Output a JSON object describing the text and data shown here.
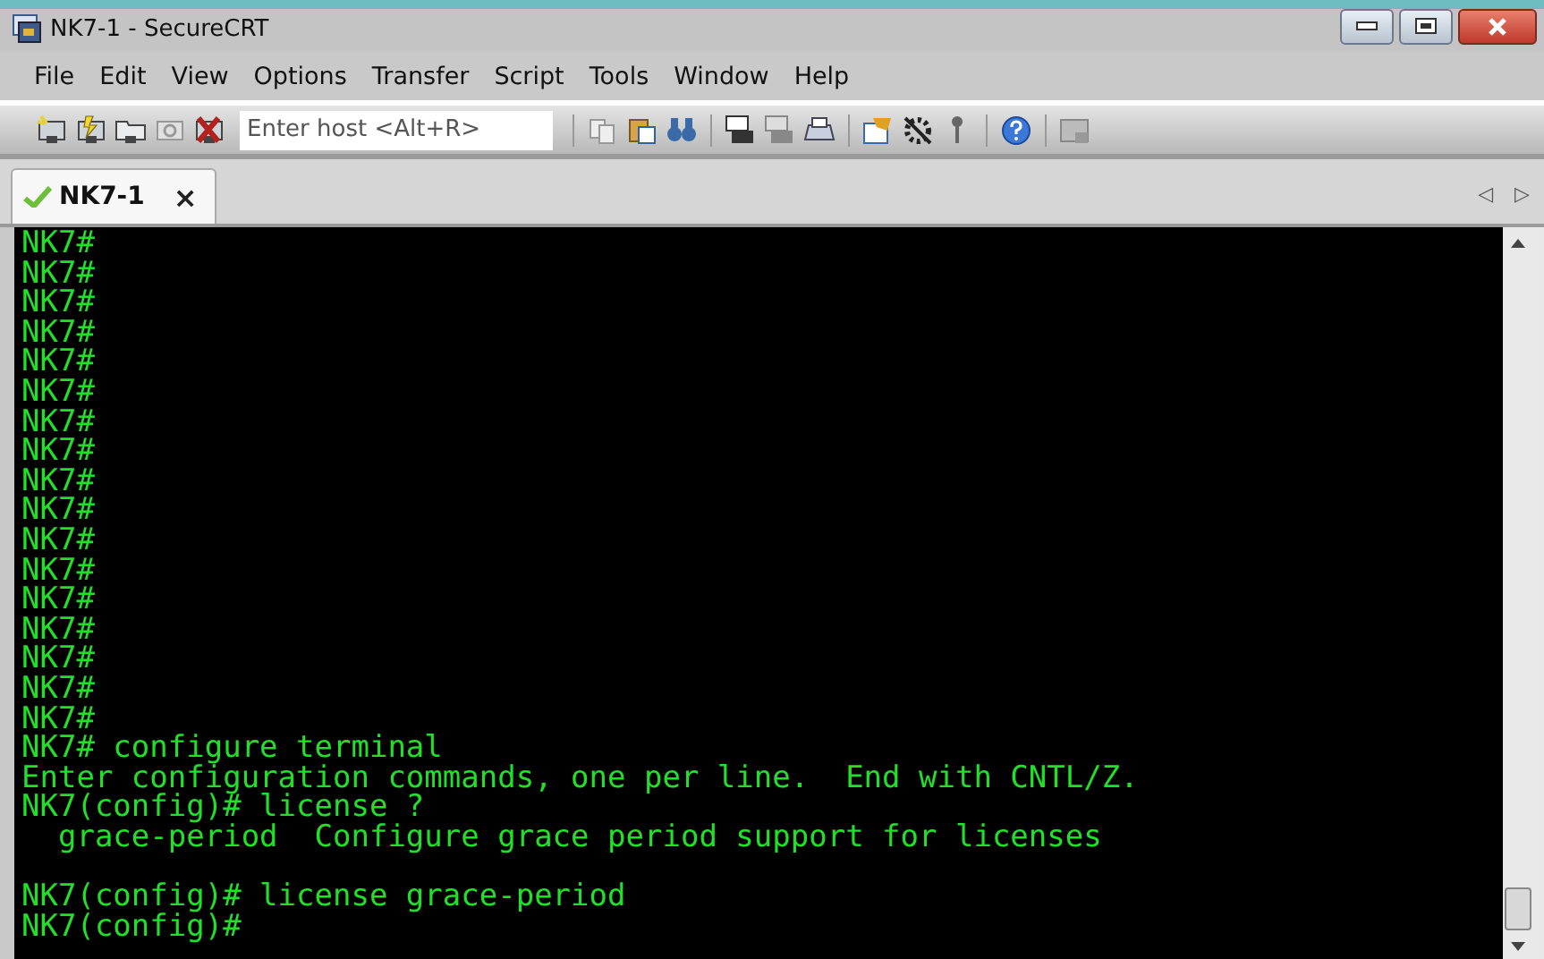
{
  "window": {
    "title": "NK7-1 - SecureCRT"
  },
  "menu": [
    "File",
    "Edit",
    "View",
    "Options",
    "Transfer",
    "Script",
    "Tools",
    "Window",
    "Help"
  ],
  "toolbar": {
    "host_field": {
      "placeholder": "Enter host <Alt+R>"
    }
  },
  "tabs": [
    {
      "label": "NK7-1",
      "selected": true,
      "connected": true,
      "close": "×"
    }
  ],
  "tab_scroll": [
    "◁",
    "▷"
  ],
  "terminal": {
    "lines": [
      "NK7#",
      "NK7#",
      "NK7#",
      "NK7#",
      "NK7#",
      "NK7#",
      "NK7#",
      "NK7#",
      "NK7#",
      "NK7#",
      "NK7#",
      "NK7#",
      "NK7#",
      "NK7#",
      "NK7#",
      "NK7#",
      "NK7#",
      "NK7# configure terminal",
      "Enter configuration commands, one per line.  End with CNTL/Z.",
      "NK7(config)# license ?",
      "  grace-period  Configure grace period support for licenses",
      {
        "kind": "blank"
      },
      "NK7(config)# license grace-period",
      "NK7(config)#"
    ]
  }
}
